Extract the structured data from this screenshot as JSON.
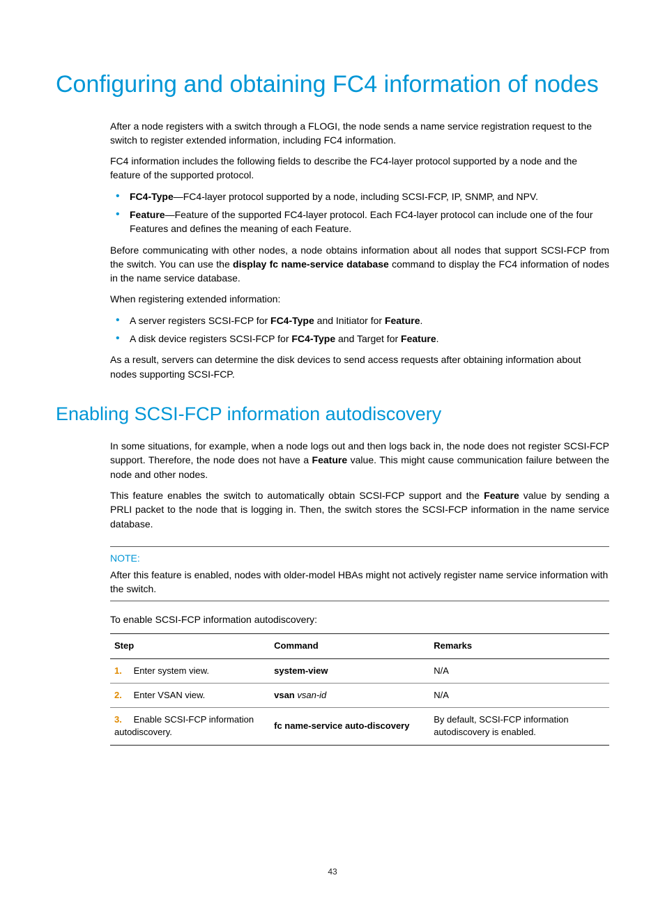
{
  "heading1": "Configuring and obtaining FC4 information of nodes",
  "intro_p1": "After a node registers with a switch through a FLOGI, the node sends a name service registration request to the switch to register extended information, including FC4 information.",
  "intro_p2": "FC4 information includes the following fields to describe the FC4-layer protocol supported by a node and the feature of the supported protocol.",
  "field_list": {
    "item1_label": "FC4-Type",
    "item1_text": "—FC4-layer protocol supported by a node, including SCSI-FCP, IP, SNMP, and NPV.",
    "item2_label": "Feature",
    "item2_text": "—Feature of the supported FC4-layer protocol. Each FC4-layer protocol can include one of the four Features and defines the meaning of each Feature."
  },
  "para_before_a": "Before communicating with other nodes, a node obtains information about all nodes that support SCSI-FCP from the switch. You can use the ",
  "para_before_cmd": "display fc name-service database",
  "para_before_b": " command to display the FC4 information of nodes in the name service database.",
  "para_when": "When registering extended information:",
  "reg_list": {
    "server_a": "A server registers SCSI-FCP for ",
    "server_b": " and Initiator for ",
    "disk_a": "A disk device registers SCSI-FCP for ",
    "disk_b": " and Target for ",
    "fc4_label": "FC4-Type",
    "feature_label": "Feature",
    "period": "."
  },
  "para_result": "As a result, servers can determine the disk devices to send access requests after obtaining information about nodes supporting SCSI-FCP.",
  "heading2": "Enabling SCSI-FCP information autodiscovery",
  "sec2_p1_a": "In some situations, for example, when a node logs out and then logs back in, the node does not register SCSI-FCP support. Therefore, the node does not have a ",
  "sec2_p1_b": " value. This might cause communication failure between the node and other nodes.",
  "sec2_p2_a": "This feature enables the switch to automatically obtain SCSI-FCP support and the ",
  "sec2_p2_b": " value by sending a PRLI packet to the node that is logging in. Then, the switch stores the SCSI-FCP information in the name service database.",
  "feature_word": "Feature",
  "note_label": "NOTE:",
  "note_body": "After this feature is enabled, nodes with older-model HBAs might not actively register name service information with the switch.",
  "to_enable": "To enable SCSI-FCP information autodiscovery:",
  "table": {
    "head_step": "Step",
    "head_command": "Command",
    "head_remarks": "Remarks",
    "rows": [
      {
        "num": "1.",
        "step": "Enter system view.",
        "command_bold": "system-view",
        "command_italic": "",
        "remarks": "N/A"
      },
      {
        "num": "2.",
        "step": "Enter VSAN view.",
        "command_bold": "vsan",
        "command_italic": " vsan-id",
        "remarks": "N/A"
      },
      {
        "num": "3.",
        "step": "Enable SCSI-FCP information autodiscovery.",
        "command_bold": "fc name-service auto-discovery",
        "command_italic": "",
        "remarks": "By default, SCSI-FCP information autodiscovery is enabled."
      }
    ]
  },
  "page_number": "43"
}
